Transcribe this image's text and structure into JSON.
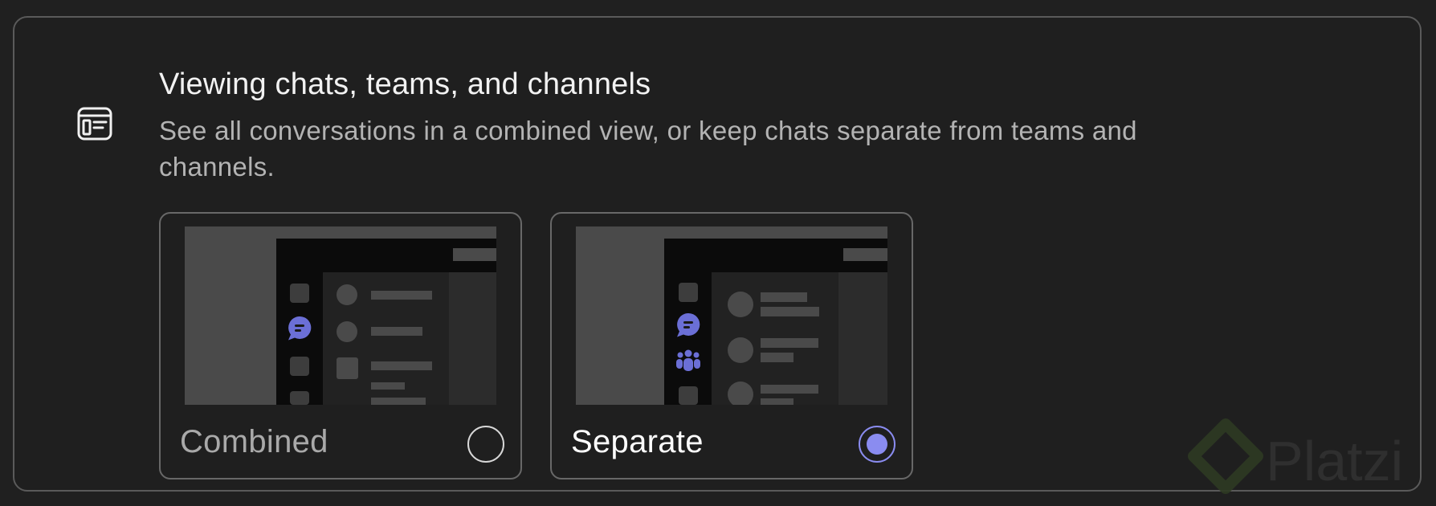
{
  "section": {
    "icon": "window-layout-icon",
    "title": "Viewing chats, teams, and channels",
    "description": "See all conversations in a combined view, or keep chats separate from teams and channels."
  },
  "options": [
    {
      "label": "Combined",
      "selected": false
    },
    {
      "label": "Separate",
      "selected": true
    }
  ],
  "colors": {
    "accent": "#8a8cf0",
    "icon_purple": "#6b6fd6",
    "background": "#1f1f1f",
    "border": "#5a5a5a"
  },
  "watermark": {
    "text": "Platzi"
  }
}
